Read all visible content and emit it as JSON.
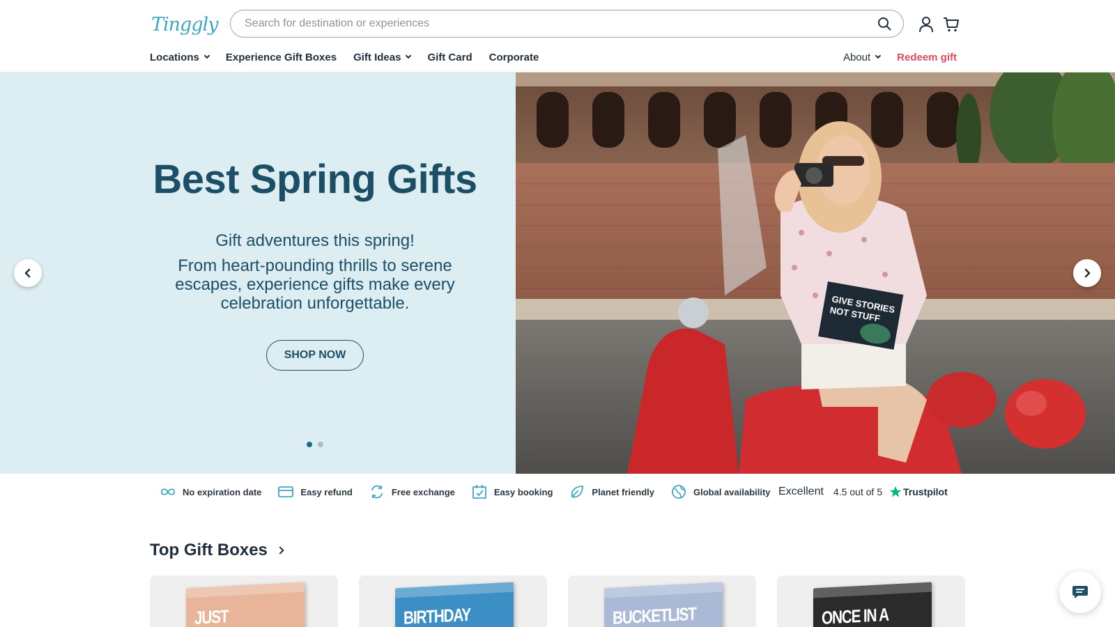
{
  "header": {
    "logo_text": "Tinggly",
    "search": {
      "placeholder": "Search for destination or experiences",
      "value": ""
    },
    "icons": {
      "search": "search-icon",
      "account": "user-icon",
      "cart": "cart-icon"
    }
  },
  "nav": {
    "left": [
      {
        "label": "Locations",
        "has_dropdown": true
      },
      {
        "label": "Experience Gift Boxes",
        "has_dropdown": false
      },
      {
        "label": "Gift Ideas",
        "has_dropdown": true
      },
      {
        "label": "Gift Card",
        "has_dropdown": false
      },
      {
        "label": "Corporate",
        "has_dropdown": false
      }
    ],
    "right": [
      {
        "label": "About",
        "has_dropdown": true
      },
      {
        "label": "Redeem gift",
        "has_dropdown": false
      }
    ]
  },
  "hero": {
    "title": "Best Spring Gifts",
    "subtitle": "Gift adventures this spring!",
    "text": "From heart-pounding thrills to serene escapes, experience gifts make every celebration unforgettable.",
    "button_label": "SHOP NOW",
    "slide_count": 2,
    "active_slide": 1,
    "image_box_text": "GIVE STORIES NOT STUFF"
  },
  "benefits": [
    {
      "icon": "infinity-icon",
      "label": "No expiration date"
    },
    {
      "icon": "card-icon",
      "label": "Easy refund"
    },
    {
      "icon": "refresh-icon",
      "label": "Free exchange"
    },
    {
      "icon": "calendar-check-icon",
      "label": "Easy booking"
    },
    {
      "icon": "leaf-icon",
      "label": "Planet friendly"
    },
    {
      "icon": "globe-icon",
      "label": "Global availability"
    }
  ],
  "trustpilot": {
    "rating_word": "Excellent",
    "rating_text": "4.5 out of 5",
    "brand": "Trustpilot",
    "star_color": "#00b67a"
  },
  "top_gift_boxes": {
    "title": "Top Gift Boxes",
    "cards": [
      {
        "label": "JUST MARRIED",
        "color": "#e8b49a"
      },
      {
        "label": "BIRTHDAY",
        "color": "#3b8fc4"
      },
      {
        "label": "BUCKETLIST",
        "color": "#a9b9d6"
      },
      {
        "label": "ONCE IN A LIFETIME",
        "color": "#2b2b2b"
      }
    ]
  },
  "colors": {
    "hero_bg": "#ddeef3",
    "hero_text": "#1c4e66",
    "accent_red": "#e24a5e",
    "brand": "#3fa6c2"
  }
}
